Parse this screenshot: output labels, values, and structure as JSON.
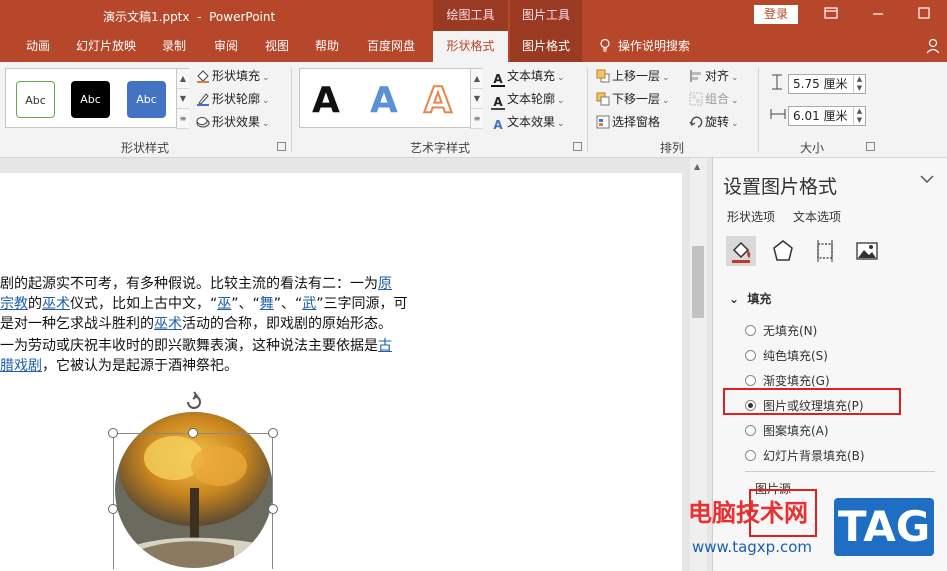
{
  "titlebar": {
    "doc_title": "演示文稿1.pptx",
    "separator": "-",
    "app_name": "PowerPoint",
    "ctx_drawing": "绘图工具",
    "ctx_picture": "图片工具",
    "login": "登录"
  },
  "tabs": [
    "动画",
    "幻灯片放映",
    "录制",
    "审阅",
    "视图",
    "帮助",
    "百度网盘",
    "形状格式",
    "图片格式"
  ],
  "tell_me": "操作说明搜索",
  "ribbon": {
    "shape_styles": {
      "label": "形状样式",
      "samples": [
        "Abc",
        "Abc",
        "Abc"
      ],
      "fill": "形状填充",
      "outline": "形状轮廓",
      "effect": "形状效果"
    },
    "wordart": {
      "label": "艺术字样式",
      "samples": [
        "A",
        "A",
        "A"
      ],
      "text_fill": "文本填充",
      "text_outline": "文本轮廓",
      "text_effect": "文本效果"
    },
    "arrange": {
      "label": "排列",
      "bring_forward": "上移一层",
      "send_backward": "下移一层",
      "selection_pane": "选择窗格",
      "align": "对齐",
      "group": "组合",
      "rotate": "旋转"
    },
    "size": {
      "label": "大小",
      "height": "5.75 厘米",
      "width": "6.01 厘米"
    }
  },
  "document": {
    "line1": [
      {
        "t": "剧的起源实不可考，有多种假说。比较主流的看法有二：一为",
        "link": false
      },
      {
        "t": "原",
        "link": true
      }
    ],
    "line2": [
      {
        "t": "宗教",
        "link": true
      },
      {
        "t": "的",
        "link": false
      },
      {
        "t": "巫术",
        "link": true
      },
      {
        "t": "仪式，比如上古中文，“",
        "link": false
      },
      {
        "t": "巫",
        "link": true
      },
      {
        "t": "”、“",
        "link": false
      },
      {
        "t": "舞",
        "link": true
      },
      {
        "t": "”、“",
        "link": false
      },
      {
        "t": "武",
        "link": true
      },
      {
        "t": "”三字同源，可",
        "link": false
      }
    ],
    "line3": [
      {
        "t": "是对一种乞求战斗胜利的",
        "link": false
      },
      {
        "t": "巫术",
        "link": true
      },
      {
        "t": "活动的合称，即戏剧的原始形态。",
        "link": false
      }
    ],
    "line4": [
      {
        "t": "一为劳动或庆祝丰收时的即兴歌舞表演，这种说法主要依据是",
        "link": false
      },
      {
        "t": "古",
        "link": true
      }
    ],
    "line5": [
      {
        "t": "腊戏剧",
        "link": true
      },
      {
        "t": "，它被认为是起源于酒神祭祀。",
        "link": false
      }
    ]
  },
  "pane": {
    "title": "设置图片格式",
    "tab_shape": "形状选项",
    "tab_text": "文本选项",
    "section": "填充",
    "options": [
      {
        "label": "无填充(N)",
        "checked": false
      },
      {
        "label": "纯色填充(S)",
        "checked": false
      },
      {
        "label": "渐变填充(G)",
        "checked": false
      },
      {
        "label": "图片或纹理填充(P)",
        "checked": true
      },
      {
        "label": "图案填充(A)",
        "checked": false
      },
      {
        "label": "幻灯片背景填充(B)",
        "checked": false
      }
    ],
    "sub_label": "图片源"
  },
  "watermark": {
    "site_name": "电脑技术网",
    "url": "www.tagxp.com",
    "tag": "TAG"
  },
  "colors": {
    "accent": "#b7472a",
    "highlight": "#e02020",
    "link": "#1f5fa8"
  }
}
